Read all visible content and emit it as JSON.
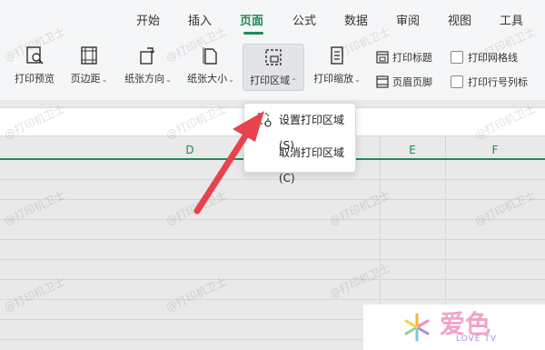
{
  "tabs": [
    {
      "label": "开始"
    },
    {
      "label": "插入"
    },
    {
      "label": "页面",
      "active": true
    },
    {
      "label": "公式"
    },
    {
      "label": "数据"
    },
    {
      "label": "审阅"
    },
    {
      "label": "视图"
    },
    {
      "label": "工具"
    }
  ],
  "toolbar": {
    "print_preview": "打印预览",
    "margins": "页边距",
    "orientation": "纸张方向",
    "paper_size": "纸张大小",
    "print_area": "打印区域",
    "print_scale": "打印缩放",
    "print_titles": "打印标题",
    "header_footer": "页眉页脚",
    "print_gridlines": "打印网格线",
    "print_headings": "打印行号列标"
  },
  "columns": {
    "d": "D",
    "e": "E",
    "f": "F"
  },
  "dropdown": {
    "set_area": "设置打印区域(S)",
    "cancel_area": "取消打印区域(C)"
  },
  "watermark": "@打印机卫士",
  "logo": {
    "main": "爱色",
    "sub": "LOVE TV"
  },
  "colors": {
    "accent": "#1f8a55",
    "arrow": "#e8424f"
  }
}
